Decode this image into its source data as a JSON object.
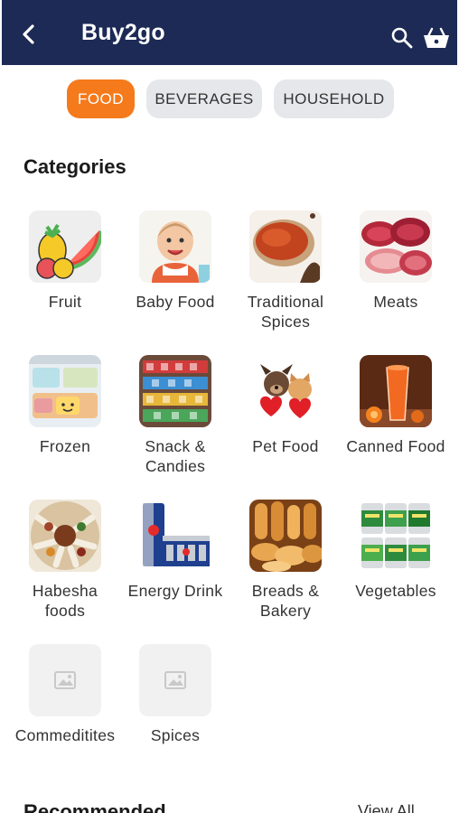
{
  "app": {
    "title": "Buy2go"
  },
  "tabs": [
    {
      "label": "FOOD",
      "active": true
    },
    {
      "label": "BEVERAGES",
      "active": false
    },
    {
      "label": "HOUSEHOLD",
      "active": false
    }
  ],
  "categories": {
    "title": "Categories",
    "items": [
      {
        "label": "Fruit",
        "icon": "fruit-icon"
      },
      {
        "label": "Baby Food",
        "icon": "baby-food-icon"
      },
      {
        "label": "Traditional Spices",
        "icon": "spices-icon"
      },
      {
        "label": "Meats",
        "icon": "meats-icon"
      },
      {
        "label": "Frozen",
        "icon": "frozen-icon"
      },
      {
        "label": "Snack & Candies",
        "icon": "snack-icon"
      },
      {
        "label": "Pet Food",
        "icon": "pet-food-icon"
      },
      {
        "label": "Canned Food",
        "icon": "canned-food-icon"
      },
      {
        "label": "Habesha foods",
        "icon": "habesha-icon"
      },
      {
        "label": "Energy Drink",
        "icon": "energy-drink-icon"
      },
      {
        "label": "Breads & Bakery",
        "icon": "bread-icon"
      },
      {
        "label": "Vegetables",
        "icon": "vegetables-icon"
      },
      {
        "label": "Commeditites",
        "icon": "image-placeholder-icon"
      },
      {
        "label": "Spices",
        "icon": "image-placeholder-icon"
      }
    ]
  },
  "recommended": {
    "title": "Recommended",
    "view_all": "View All"
  },
  "colors": {
    "appbar": "#1c2a55",
    "accent": "#f47a1c",
    "tab_bg": "#e6e7ea"
  }
}
